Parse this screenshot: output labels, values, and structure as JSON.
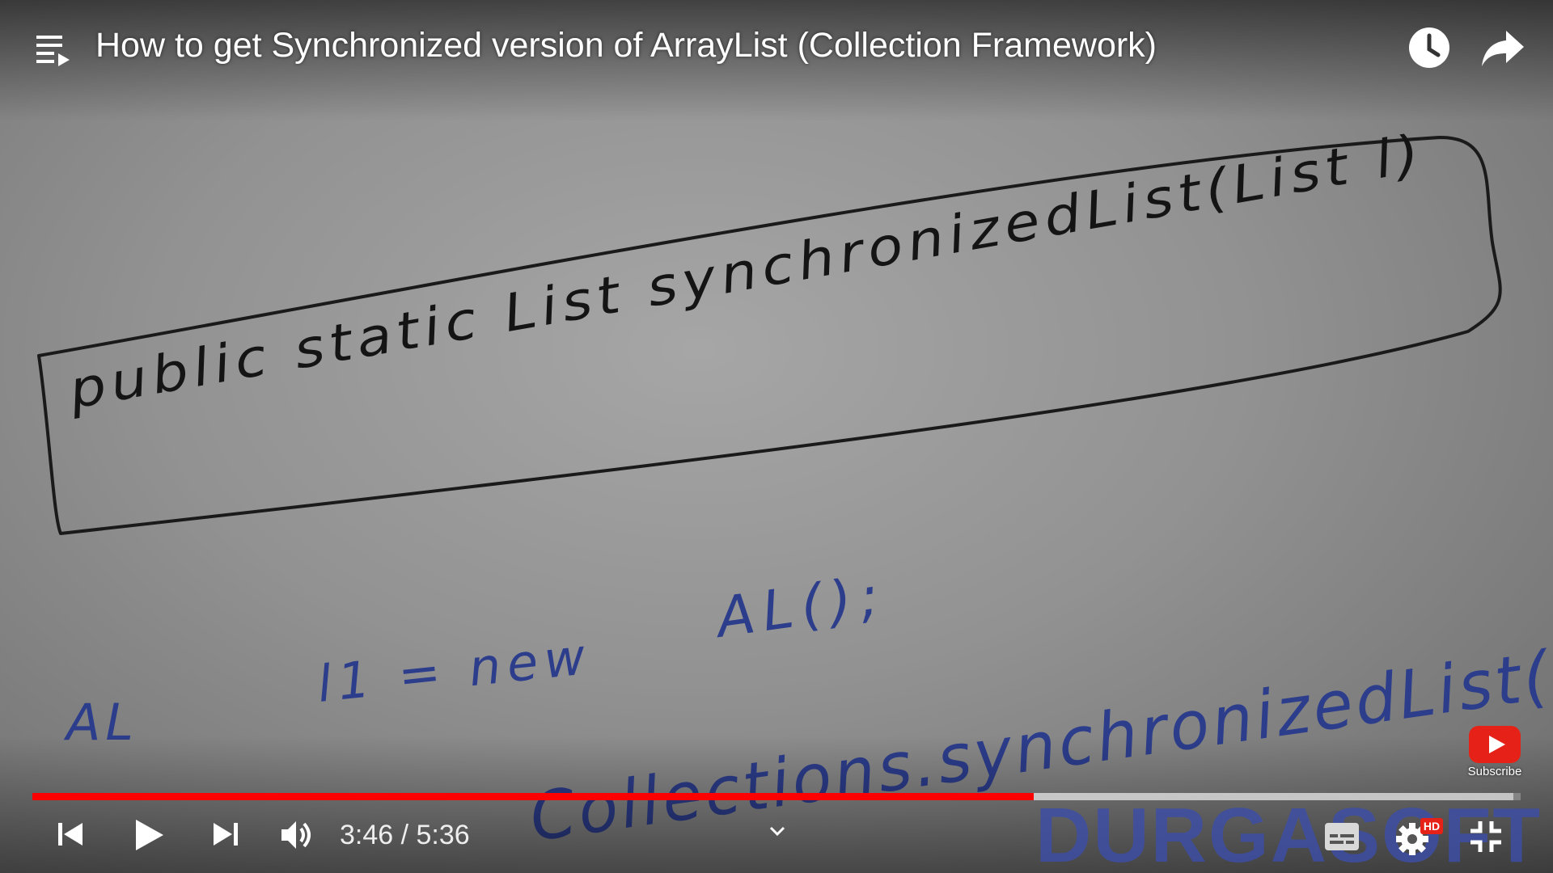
{
  "video": {
    "title": "How to get Synchronized version of ArrayList (Collection Framework)",
    "current_time": "3:46",
    "duration": "5:36",
    "time_display": "3:46 / 5:36",
    "progress_fraction": 0.673,
    "buffered_fraction": 0.995
  },
  "board": {
    "boxed_line": "public static List synchronizedList(List l)",
    "line2_left": "AL",
    "line2_mid": "l1 = new",
    "line2_right": "AL();",
    "line3": "Collections.synchronizedList(l"
  },
  "overlay": {
    "subscribe_label": "Subscribe",
    "watermark": "DURGASOFT",
    "hd_badge": "HD"
  },
  "colors": {
    "progress_red": "#ff0000",
    "ink_black": "#141414",
    "ink_blue": "#2c3d8c",
    "watermark_blue": "#3d4ea8"
  },
  "icons": [
    "playlist-icon",
    "watch-later-icon",
    "share-icon",
    "previous-icon",
    "play-icon",
    "next-icon",
    "volume-icon",
    "subtitles-icon",
    "settings-icon",
    "exit-fullscreen-icon",
    "chevron-down-icon",
    "youtube-logo-icon"
  ]
}
